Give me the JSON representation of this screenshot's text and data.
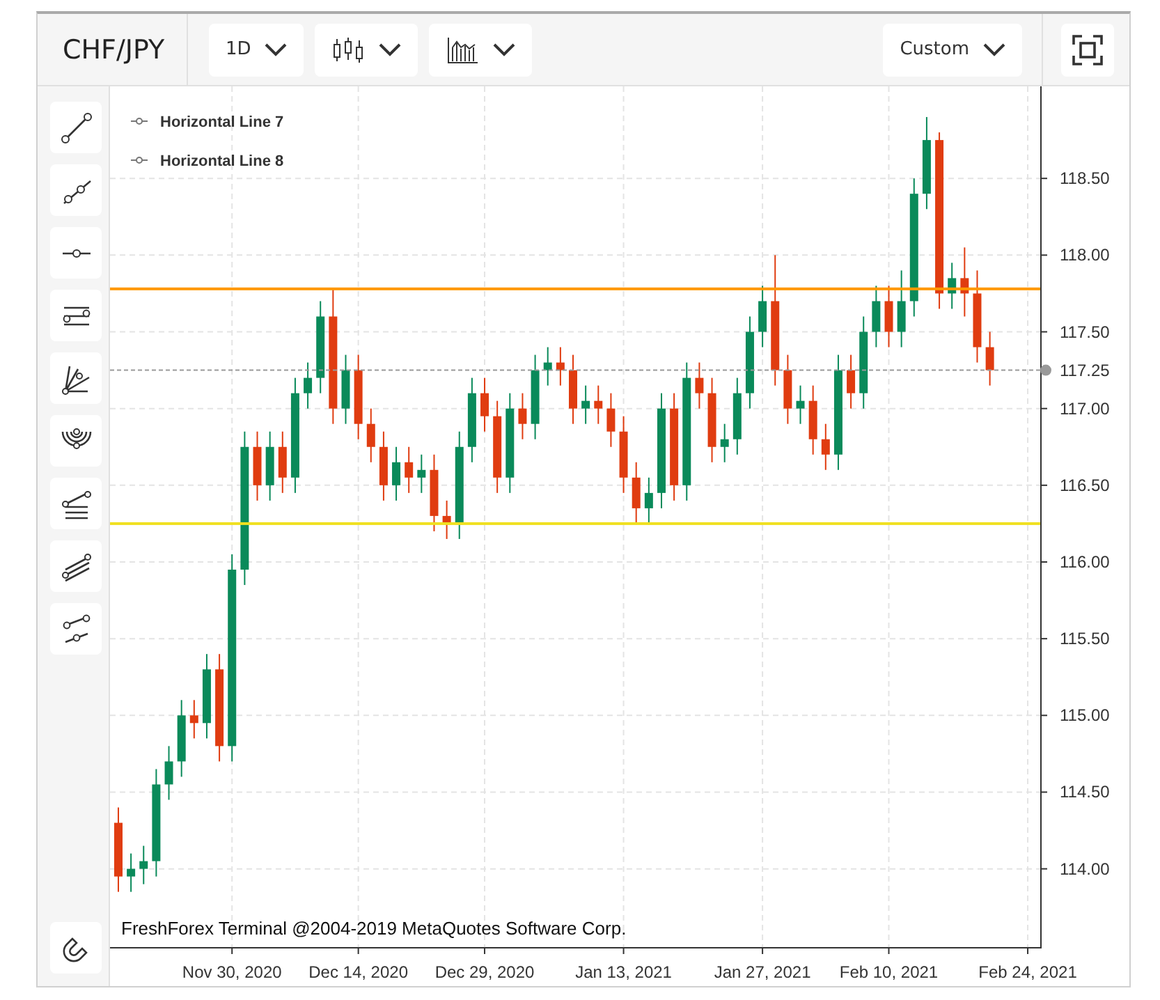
{
  "header": {
    "symbol": "CHF/JPY",
    "timeframe": "1D",
    "range": "Custom"
  },
  "tools": [
    {
      "kind": "trend"
    },
    {
      "kind": "ray"
    },
    {
      "kind": "hline"
    },
    {
      "kind": "channel"
    },
    {
      "kind": "fan"
    },
    {
      "kind": "arcs"
    },
    {
      "kind": "levels"
    },
    {
      "kind": "parallel"
    },
    {
      "kind": "pair"
    }
  ],
  "legend": [
    {
      "label": "Horizontal Line 7"
    },
    {
      "label": "Horizontal Line 8"
    }
  ],
  "current_price": "117.25",
  "copyright": "FreshForex Terminal @2004-2019 MetaQuotes Software Corp.",
  "chart_data": {
    "type": "candlestick",
    "categories": [
      null,
      null,
      null,
      null,
      null,
      null,
      null,
      null,
      null,
      "Nov 30, 2020",
      null,
      null,
      null,
      null,
      null,
      null,
      null,
      null,
      null,
      "Dec 14, 2020",
      null,
      null,
      null,
      null,
      null,
      null,
      null,
      null,
      null,
      "Dec 29, 2020",
      null,
      null,
      null,
      null,
      null,
      null,
      null,
      null,
      null,
      null,
      "Jan 13, 2021",
      null,
      null,
      null,
      null,
      null,
      null,
      null,
      null,
      null,
      null,
      "Jan 27, 2021",
      null,
      null,
      null,
      null,
      null,
      null,
      null,
      null,
      null,
      "Feb 10, 2021",
      null,
      null,
      null,
      null,
      null,
      null,
      null,
      null,
      null,
      null,
      "Feb 24, 2021"
    ],
    "ohlc": [
      [
        114.3,
        114.4,
        113.85,
        113.95
      ],
      [
        113.95,
        114.1,
        113.85,
        114.0
      ],
      [
        114.0,
        114.15,
        113.9,
        114.05
      ],
      [
        114.05,
        114.65,
        113.95,
        114.55
      ],
      [
        114.55,
        114.8,
        114.45,
        114.7
      ],
      [
        114.7,
        115.1,
        114.6,
        115.0
      ],
      [
        115.0,
        115.1,
        114.85,
        114.95
      ],
      [
        114.95,
        115.4,
        114.85,
        115.3
      ],
      [
        115.3,
        115.4,
        114.7,
        114.8
      ],
      [
        114.8,
        116.05,
        114.7,
        115.95
      ],
      [
        115.95,
        116.85,
        115.85,
        116.75
      ],
      [
        116.75,
        116.85,
        116.4,
        116.5
      ],
      [
        116.5,
        116.85,
        116.4,
        116.75
      ],
      [
        116.75,
        116.85,
        116.45,
        116.55
      ],
      [
        116.55,
        117.2,
        116.45,
        117.1
      ],
      [
        117.1,
        117.3,
        117.0,
        117.2
      ],
      [
        117.2,
        117.7,
        117.1,
        117.6
      ],
      [
        117.6,
        117.78,
        116.9,
        117.0
      ],
      [
        117.0,
        117.35,
        116.9,
        117.25
      ],
      [
        117.25,
        117.35,
        116.8,
        116.9
      ],
      [
        116.9,
        117.0,
        116.65,
        116.75
      ],
      [
        116.75,
        116.85,
        116.4,
        116.5
      ],
      [
        116.5,
        116.75,
        116.4,
        116.65
      ],
      [
        116.65,
        116.75,
        116.45,
        116.55
      ],
      [
        116.55,
        116.7,
        116.45,
        116.6
      ],
      [
        116.6,
        116.7,
        116.2,
        116.3
      ],
      [
        116.3,
        116.4,
        116.15,
        116.25
      ],
      [
        116.25,
        116.85,
        116.15,
        116.75
      ],
      [
        116.75,
        117.2,
        116.65,
        117.1
      ],
      [
        117.1,
        117.2,
        116.85,
        116.95
      ],
      [
        116.95,
        117.05,
        116.45,
        116.55
      ],
      [
        116.55,
        117.1,
        116.45,
        117.0
      ],
      [
        117.0,
        117.1,
        116.8,
        116.9
      ],
      [
        116.9,
        117.35,
        116.8,
        117.25
      ],
      [
        117.25,
        117.4,
        117.15,
        117.3
      ],
      [
        117.3,
        117.4,
        117.15,
        117.25
      ],
      [
        117.25,
        117.35,
        116.9,
        117.0
      ],
      [
        117.0,
        117.15,
        116.9,
        117.05
      ],
      [
        117.05,
        117.15,
        116.9,
        117.0
      ],
      [
        117.0,
        117.1,
        116.75,
        116.85
      ],
      [
        116.85,
        116.95,
        116.45,
        116.55
      ],
      [
        116.55,
        116.65,
        116.25,
        116.35
      ],
      [
        116.35,
        116.55,
        116.25,
        116.45
      ],
      [
        116.45,
        117.1,
        116.35,
        117.0
      ],
      [
        117.0,
        117.1,
        116.4,
        116.5
      ],
      [
        116.5,
        117.3,
        116.4,
        117.2
      ],
      [
        117.2,
        117.3,
        117.0,
        117.1
      ],
      [
        117.1,
        117.2,
        116.65,
        116.75
      ],
      [
        116.75,
        116.9,
        116.65,
        116.8
      ],
      [
        116.8,
        117.2,
        116.7,
        117.1
      ],
      [
        117.1,
        117.6,
        117.0,
        117.5
      ],
      [
        117.5,
        117.8,
        117.4,
        117.7
      ],
      [
        117.7,
        118.0,
        117.15,
        117.25
      ],
      [
        117.25,
        117.35,
        116.9,
        117.0
      ],
      [
        117.0,
        117.15,
        116.9,
        117.05
      ],
      [
        117.05,
        117.15,
        116.7,
        116.8
      ],
      [
        116.8,
        116.9,
        116.6,
        116.7
      ],
      [
        116.7,
        117.35,
        116.6,
        117.25
      ],
      [
        117.25,
        117.35,
        117.0,
        117.1
      ],
      [
        117.1,
        117.6,
        117.0,
        117.5
      ],
      [
        117.5,
        117.8,
        117.4,
        117.7
      ],
      [
        117.7,
        117.8,
        117.4,
        117.5
      ],
      [
        117.5,
        117.9,
        117.4,
        117.7
      ],
      [
        117.7,
        118.5,
        117.6,
        118.4
      ],
      [
        118.4,
        118.9,
        118.3,
        118.75
      ],
      [
        118.75,
        118.8,
        117.65,
        117.75
      ],
      [
        117.75,
        117.95,
        117.65,
        117.85
      ],
      [
        117.85,
        118.05,
        117.6,
        117.75
      ],
      [
        117.75,
        117.9,
        117.3,
        117.4
      ],
      [
        117.4,
        117.5,
        117.15,
        117.25
      ],
      null,
      null,
      null
    ],
    "ylim": [
      113.49,
      119.1
    ],
    "grid": true,
    "ref_lines": [
      {
        "axis": "y",
        "value": 117.78,
        "color": "#ff9800"
      },
      {
        "axis": "y",
        "value": 116.25,
        "color": "#f0e020"
      },
      {
        "axis": "y",
        "value": 117.25,
        "color": "#999999"
      }
    ],
    "yticks": [
      {
        "value": 118.5,
        "label": "118.50"
      },
      {
        "value": 118,
        "label": "118.00"
      },
      {
        "value": 117.5,
        "label": "117.50"
      },
      {
        "value": 117,
        "label": "117.00"
      },
      {
        "value": 116.5,
        "label": "116.50"
      },
      {
        "value": 116,
        "label": "116.00"
      },
      {
        "value": 115.5,
        "label": "115.50"
      },
      {
        "value": 115,
        "label": "115.00"
      },
      {
        "value": 114.5,
        "label": "114.50"
      },
      {
        "value": 114,
        "label": "114.00"
      }
    ],
    "stacked": false
  }
}
